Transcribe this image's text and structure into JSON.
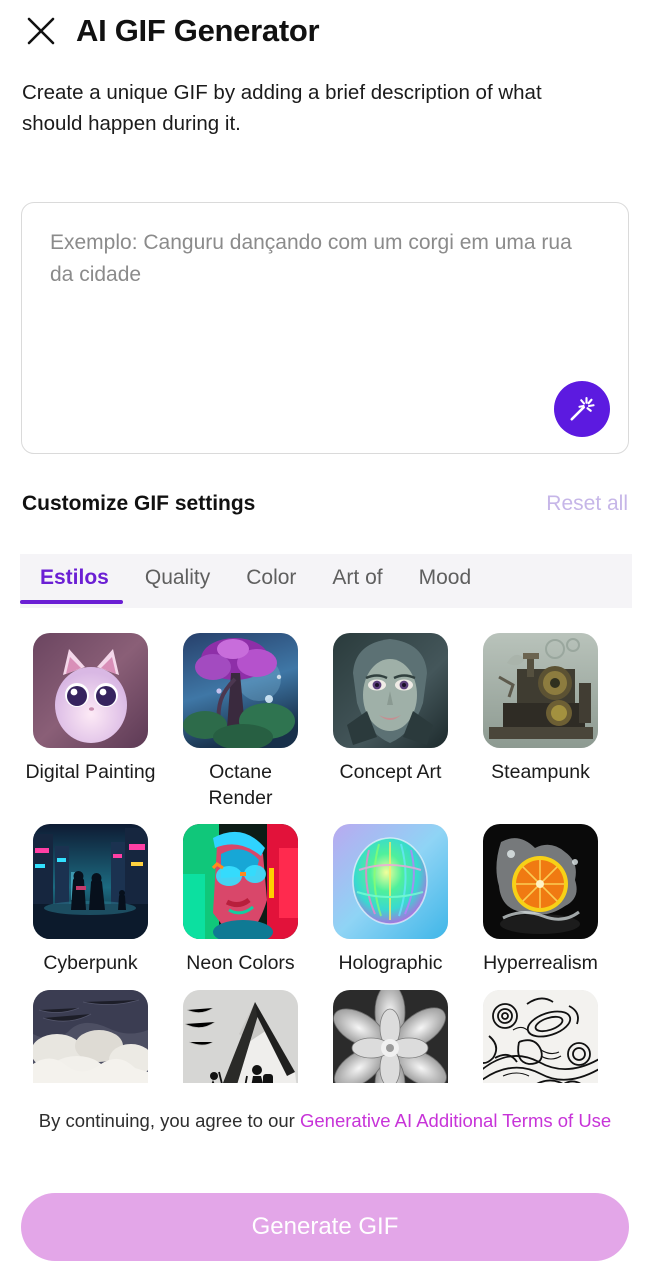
{
  "header": {
    "close_icon": "close-icon",
    "title": "AI GIF Generator"
  },
  "description": "Create a unique GIF by adding a brief description of what should happen during it.",
  "prompt": {
    "value": "",
    "placeholder": "Exemplo: Canguru dançando com um corgi em uma rua da cidade",
    "magic_icon": "magic-wand-icon"
  },
  "settings": {
    "title": "Customize GIF settings",
    "reset_label": "Reset all",
    "reset_color": "#c6b6e8"
  },
  "tabs": {
    "active_index": 0,
    "active_color": "#6b1fd4",
    "items": [
      {
        "label": "Estilos"
      },
      {
        "label": "Quality"
      },
      {
        "label": "Color"
      },
      {
        "label": "Art of"
      },
      {
        "label": "Mood"
      }
    ]
  },
  "styles": {
    "rows": [
      [
        {
          "label": "Digital Painting",
          "thumb": "fluffy-pink-cat-thumb"
        },
        {
          "label": "Octane Render",
          "thumb": "purple-tree-forest-thumb"
        },
        {
          "label": "Concept Art",
          "thumb": "armored-face-thumb"
        },
        {
          "label": "Steampunk",
          "thumb": "steampunk-machine-thumb"
        }
      ],
      [
        {
          "label": "Cyberpunk",
          "thumb": "neon-city-silhouettes-thumb"
        },
        {
          "label": "Neon Colors",
          "thumb": "neon-portrait-glasses-thumb"
        },
        {
          "label": "Holographic",
          "thumb": "iridescent-sphere-thumb"
        },
        {
          "label": "Hyperrealism",
          "thumb": "orange-splash-thumb"
        }
      ],
      [
        {
          "label": "",
          "thumb": "charcoal-clouds-thumb"
        },
        {
          "label": "",
          "thumb": "mountain-engraving-thumb"
        },
        {
          "label": "",
          "thumb": "grayscale-flower-thumb"
        },
        {
          "label": "",
          "thumb": "black-white-line-art-thumb"
        }
      ]
    ]
  },
  "legal": {
    "prefix": "By continuing, you agree to our ",
    "link": "Generative AI Additional Terms of Use",
    "link_color": "#c733d8"
  },
  "generate": {
    "label": "Generate GIF",
    "color": "#e3a6e8"
  }
}
